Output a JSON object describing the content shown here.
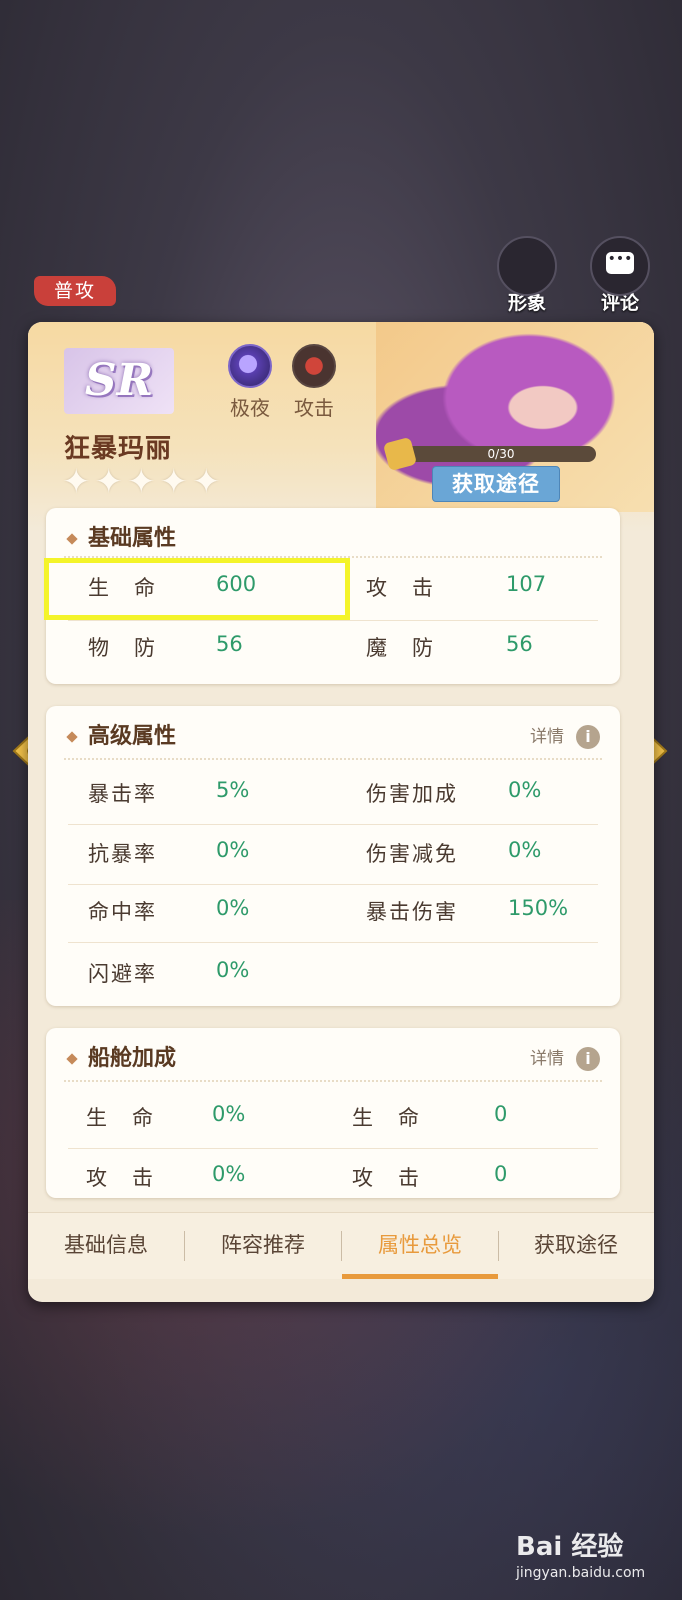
{
  "top_tag": "普攻",
  "top_buttons": {
    "appearance": "形象",
    "comment": "评论"
  },
  "hero": {
    "rarity": "SR",
    "faction": "极夜",
    "role": "攻击",
    "name": "狂暴玛丽",
    "stars": 5,
    "fragments": "0/30",
    "get_button": "获取途径"
  },
  "basic": {
    "title": "基础属性",
    "rows": [
      [
        {
          "label": "生　命",
          "value": "600"
        },
        {
          "label": "攻　击",
          "value": "107"
        }
      ],
      [
        {
          "label": "物　防",
          "value": "56"
        },
        {
          "label": "魔　防",
          "value": "56"
        }
      ]
    ]
  },
  "advanced": {
    "title": "高级属性",
    "detail": "详情",
    "rows": [
      [
        {
          "label": "暴击率",
          "value": "5%"
        },
        {
          "label": "伤害加成",
          "value": "0%"
        }
      ],
      [
        {
          "label": "抗暴率",
          "value": "0%"
        },
        {
          "label": "伤害减免",
          "value": "0%"
        }
      ],
      [
        {
          "label": "命中率",
          "value": "0%"
        },
        {
          "label": "暴击伤害",
          "value": "150%"
        }
      ],
      [
        {
          "label": "闪避率",
          "value": "0%"
        }
      ]
    ]
  },
  "ship": {
    "title": "船舱加成",
    "detail": "详情",
    "rows": [
      [
        {
          "label": "生　命",
          "value": "0%"
        },
        {
          "label": "生　命",
          "value": "0"
        }
      ],
      [
        {
          "label": "攻　击",
          "value": "0%"
        },
        {
          "label": "攻　击",
          "value": "0"
        }
      ]
    ]
  },
  "tabs": [
    "基础信息",
    "阵容推荐",
    "属性总览",
    "获取途径"
  ],
  "active_tab": "属性总览",
  "watermark": {
    "brand": "Bai 经验",
    "url": "jingyan.baidu.com"
  }
}
